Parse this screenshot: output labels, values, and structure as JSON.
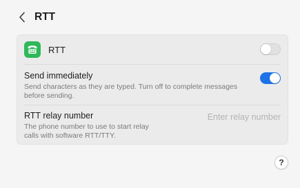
{
  "header": {
    "back_icon": "chevron-left-icon",
    "title": "RTT"
  },
  "rtt": {
    "icon": "tty-phone-icon",
    "label": "RTT",
    "enabled": false
  },
  "send_immediately": {
    "title": "Send immediately",
    "description": "Send characters as they are typed. Turn off to complete messages before sending.",
    "enabled": true
  },
  "relay_number": {
    "title": "RTT relay number",
    "description": "The phone number to use to start relay calls with software RTT/TTY.",
    "value": "",
    "placeholder": "Enter relay number"
  },
  "help": {
    "label": "?"
  },
  "colors": {
    "accent": "#1c73e8",
    "rtt_icon_bg": "#2fb85a"
  }
}
